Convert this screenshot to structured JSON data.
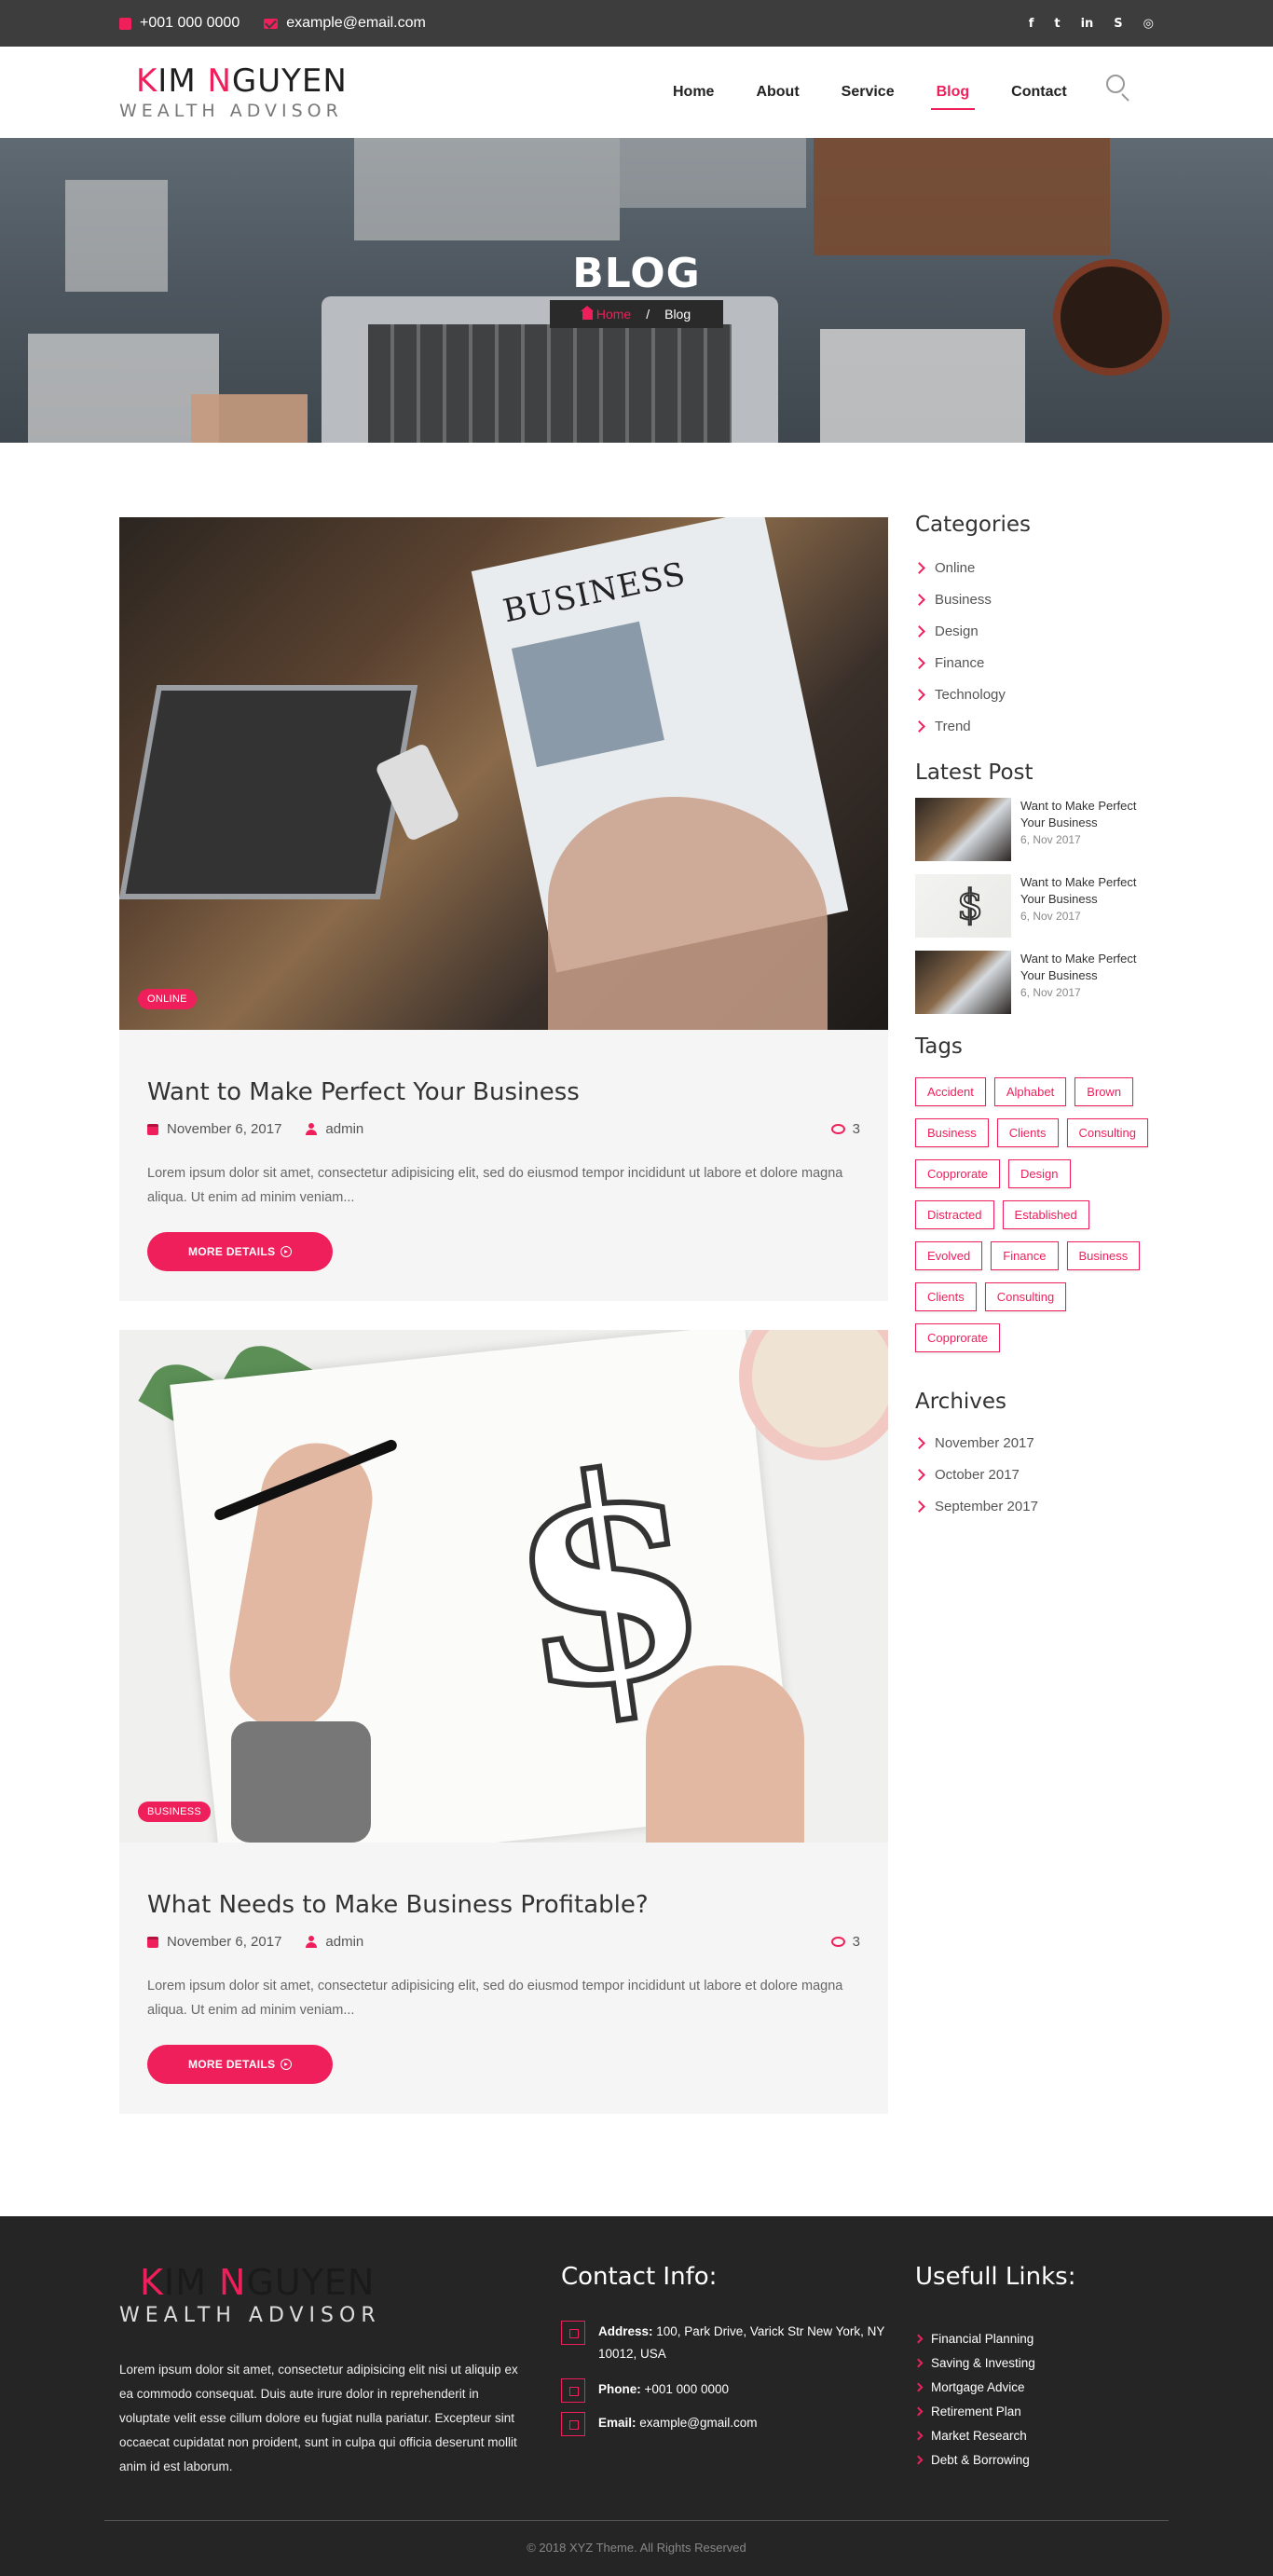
{
  "topbar": {
    "phone": "+001 000 0000",
    "email": "example@email.com",
    "social": [
      {
        "icon": "facebook-icon",
        "glyph": "f"
      },
      {
        "icon": "twitter-icon",
        "glyph": "t"
      },
      {
        "icon": "linkedin-icon",
        "glyph": "in"
      },
      {
        "icon": "skype-icon",
        "glyph": "S"
      },
      {
        "icon": "instagram-icon",
        "glyph": "◎"
      }
    ]
  },
  "brand": {
    "name_first_initial": "K",
    "name_first_rest": "IM ",
    "name_last_initial": "N",
    "name_last_rest": "GUYEN",
    "tagline": "WEALTH ADVISOR"
  },
  "nav": {
    "items": [
      "Home",
      "About",
      "Service",
      "Blog",
      "Contact"
    ],
    "active": "Blog"
  },
  "hero": {
    "title": "BLOG",
    "breadcrumb_home": "Home",
    "breadcrumb_sep": "/",
    "breadcrumb_current": "Blog"
  },
  "posts": [
    {
      "badge": "ONLINE",
      "title": "Want to Make Perfect Your Business",
      "date": "November 6, 2017",
      "author": "admin",
      "comments": "3",
      "excerpt": "Lorem ipsum dolor sit amet, consectetur adipisicing elit, sed do eiusmod tempor incididunt ut labore et dolore magna aliqua. Ut enim ad minim veniam...",
      "button": "MORE DETAILS"
    },
    {
      "badge": "BUSINESS",
      "title": "What Needs to Make Business Profitable?",
      "date": "November 6, 2017",
      "author": "admin",
      "comments": "3",
      "excerpt": "Lorem ipsum dolor sit amet, consectetur adipisicing elit, sed do eiusmod tempor incididunt ut labore et dolore magna aliqua. Ut enim ad minim veniam...",
      "button": "MORE DETAILS"
    }
  ],
  "sidebar": {
    "categories_title": "Categories",
    "categories": [
      "Online",
      "Business",
      "Design",
      "Finance",
      "Technology",
      "Trend"
    ],
    "latest_title": "Latest Post",
    "latest": [
      {
        "title": "Want to Make Perfect Your Business",
        "date": "6, Nov 2017"
      },
      {
        "title": "Want to Make Perfect Your Business",
        "date": "6, Nov 2017"
      },
      {
        "title": "Want to Make Perfect Your Business",
        "date": "6, Nov 2017"
      }
    ],
    "tags_title": "Tags",
    "tags": [
      "Accident",
      "Alphabet",
      "Brown",
      "Business",
      "Clients",
      "Consulting",
      "Copprorate",
      "Design",
      "Distracted",
      "Established",
      "Evolved",
      "Finance",
      "Business",
      "Clients",
      "Consulting",
      "Copprorate"
    ],
    "archives_title": "Archives",
    "archives": [
      "November 2017",
      "October 2017",
      "September 2017"
    ]
  },
  "footer": {
    "about": "Lorem ipsum dolor sit amet, consectetur adipisicing elit nisi ut aliquip ex ea commodo consequat. Duis aute irure dolor in reprehenderit in voluptate velit esse cillum dolore eu fugiat nulla pariatur. Excepteur sint occaecat cupidatat non proident, sunt in culpa qui officia deserunt mollit anim id est laborum.",
    "contact_title": "Contact Info:",
    "address_label": "Address:",
    "address": "100, Park Drive, Varick Str New York, NY 10012, USA",
    "phone_label": "Phone:",
    "phone": "+001 000 0000",
    "email_label": "Email:",
    "email": "example@gmail.com",
    "links_title": "Usefull Links:",
    "links": [
      "Financial Planning",
      "Saving & Investing",
      "Mortgage Advice",
      "Retirement Plan",
      "Market Research",
      "Debt & Borrowing"
    ],
    "copyright": "© 2018 XYZ Theme. All Rights Reserved"
  },
  "colors": {
    "accent": "#ef1f5b",
    "topbar": "#3d3d3d",
    "footer": "#252525"
  }
}
